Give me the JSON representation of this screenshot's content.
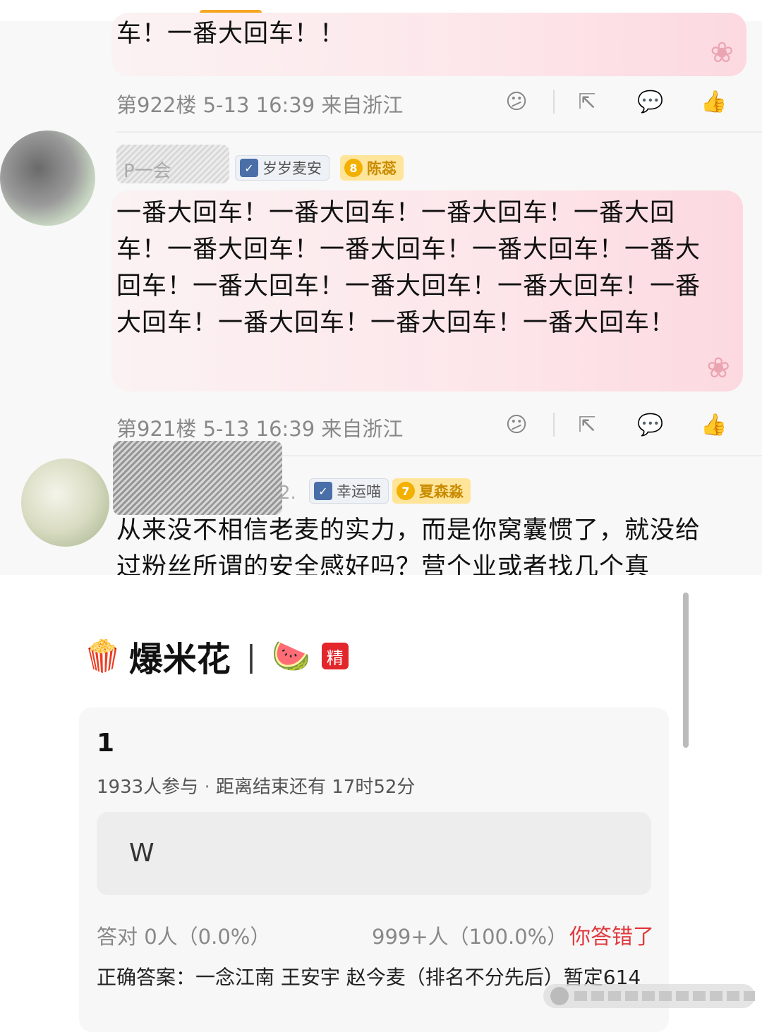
{
  "comments": [
    {
      "text": "车！一番大回车！！",
      "floor": "第922楼",
      "time": "5-13 16:39",
      "location": "来自浙江"
    },
    {
      "username": "P一会",
      "badge_fan": "岁岁麦安",
      "badge_level": "8",
      "badge_level_name": "陈蕊",
      "text": "一番大回车！一番大回车！一番大回车！一番大回车！一番大回车！一番大回车！一番大回车！一番大回车！一番大回车！一番大回车！一番大回车！一番大回车！一番大回车！一番大回车！一番大回车！",
      "floor": "第921楼",
      "time": "5-13 16:39",
      "location": "来自浙江"
    },
    {
      "username": "2.",
      "badge_fan": "幸运喵",
      "badge_level": "7",
      "badge_level_name": "夏森淼",
      "text": "从来没不相信老麦的实力，而是你窝囊惯了，就没给过粉丝所谓的安全感好吗？营个业或者找几个真"
    }
  ],
  "icons": {
    "dislike": "😕",
    "share": "⇱",
    "comment": "💬",
    "like": "👍"
  },
  "group": {
    "emoji": "🍿",
    "title": "爆米花",
    "separator": "|",
    "emoji2": "🍉",
    "tag": "精"
  },
  "quiz": {
    "number": "1",
    "participants": "1933人参与",
    "dot": "·",
    "countdown": "距离结束还有 17时52分",
    "option": "W",
    "correct_stat": "答对  0人（0.0%）",
    "wrong_stat": "999+人（100.0%）",
    "result": "你答错了",
    "answer": "正确答案：一念江南 王安宇 赵今麦（排名不分先后）暂定614"
  },
  "colors": {
    "accent_red": "#e0393e",
    "tab_indicator": "#f5a623"
  }
}
